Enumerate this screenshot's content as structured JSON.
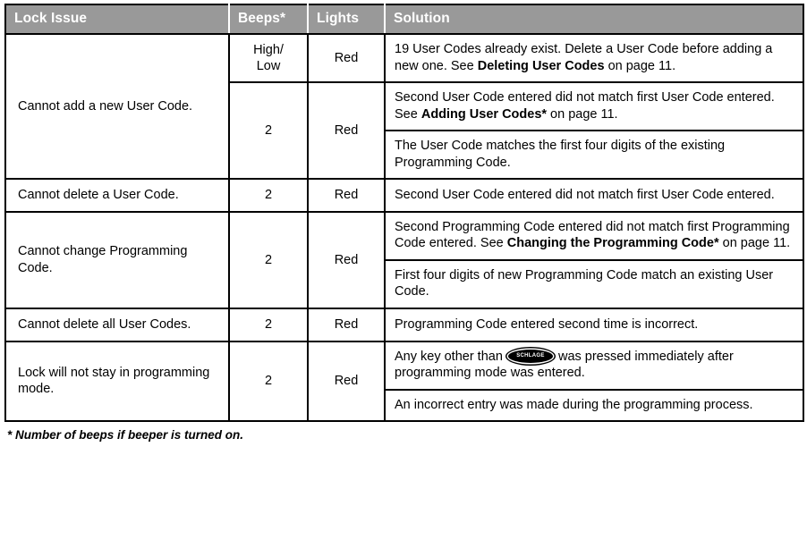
{
  "table": {
    "headers": [
      {
        "label": "Lock Issue",
        "key": "lock-issue"
      },
      {
        "label": "Beeps*",
        "key": "beeps"
      },
      {
        "label": "Lights",
        "key": "lights"
      },
      {
        "label": "Solution",
        "key": "solution"
      }
    ],
    "header_background": "#999999",
    "header_text_color": "#ffffff",
    "border_color": "#000000",
    "rows": [
      {
        "issue": "Cannot add a new User Code.",
        "groups": [
          {
            "beeps": "High/ Low",
            "beeps_line1": "High/",
            "beeps_line2": "Low",
            "lights": "Red",
            "solutions": [
              {
                "pre": "19 User Codes already exist. Delete a User Code before adding a new one. See ",
                "bold": "Deleting User Codes",
                "post": " on page 11."
              }
            ]
          },
          {
            "beeps": "2",
            "lights": "Red",
            "solutions": [
              {
                "pre": "Second User Code entered did not match first User Code entered. See ",
                "bold": "Adding User Codes*",
                "post": " on page 11."
              },
              {
                "pre": "The User Code matches the first four digits of the existing Programming Code.",
                "bold": "",
                "post": ""
              }
            ]
          }
        ]
      },
      {
        "issue": "Cannot delete a User Code.",
        "groups": [
          {
            "beeps": "2",
            "lights": "Red",
            "solutions": [
              {
                "pre": "Second User Code entered did not match first User Code entered.",
                "bold": "",
                "post": ""
              }
            ]
          }
        ]
      },
      {
        "issue": "Cannot change Programming Code.",
        "groups": [
          {
            "beeps": "2",
            "lights": "Red",
            "solutions": [
              {
                "pre": "Second Programming Code entered did not match first Programming Code entered. See ",
                "bold": "Changing the Programming Code*",
                "post": " on page 11."
              },
              {
                "pre": "First four digits of new Programming Code match an existing User Code.",
                "bold": "",
                "post": ""
              }
            ]
          }
        ]
      },
      {
        "issue": "Cannot delete all User Codes.",
        "groups": [
          {
            "beeps": "2",
            "lights": "Red",
            "solutions": [
              {
                "pre": "Programming Code entered second time is incorrect.",
                "bold": "",
                "post": ""
              }
            ]
          }
        ]
      },
      {
        "issue": "Lock will not stay in programming mode.",
        "groups": [
          {
            "beeps": "2",
            "lights": "Red",
            "solutions": [
              {
                "pre": "Any key other than ",
                "logo": "SCHLAGE",
                "post": " was pressed immediately after programming mode was entered."
              },
              {
                "pre": "An incorrect entry was made during the programming process.",
                "bold": "",
                "post": ""
              }
            ]
          }
        ]
      }
    ]
  },
  "footnote": "* Number of beeps if beeper is turned on."
}
